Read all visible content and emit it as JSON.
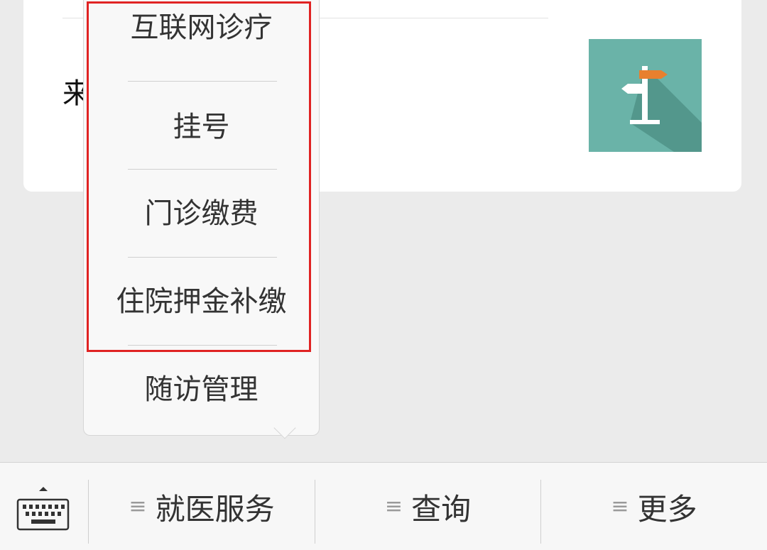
{
  "card": {
    "partial_text": "来"
  },
  "popup_menu": {
    "items": [
      {
        "label": "互联网诊疗"
      },
      {
        "label": "挂号"
      },
      {
        "label": "门诊缴费"
      },
      {
        "label": "住院押金补缴"
      },
      {
        "label": "随访管理"
      }
    ]
  },
  "bottom_bar": {
    "keyboard_icon": "keyboard-icon",
    "tabs": [
      {
        "label": "就医服务",
        "icon": "menu-lines-icon"
      },
      {
        "label": "查询",
        "icon": "menu-lines-icon"
      },
      {
        "label": "更多",
        "icon": "menu-lines-icon"
      }
    ],
    "menu_glyph": "≡"
  },
  "colors": {
    "highlight_border": "#e02323",
    "thumb_bg": "#6ab3a8",
    "sign_accent": "#e8802e"
  }
}
